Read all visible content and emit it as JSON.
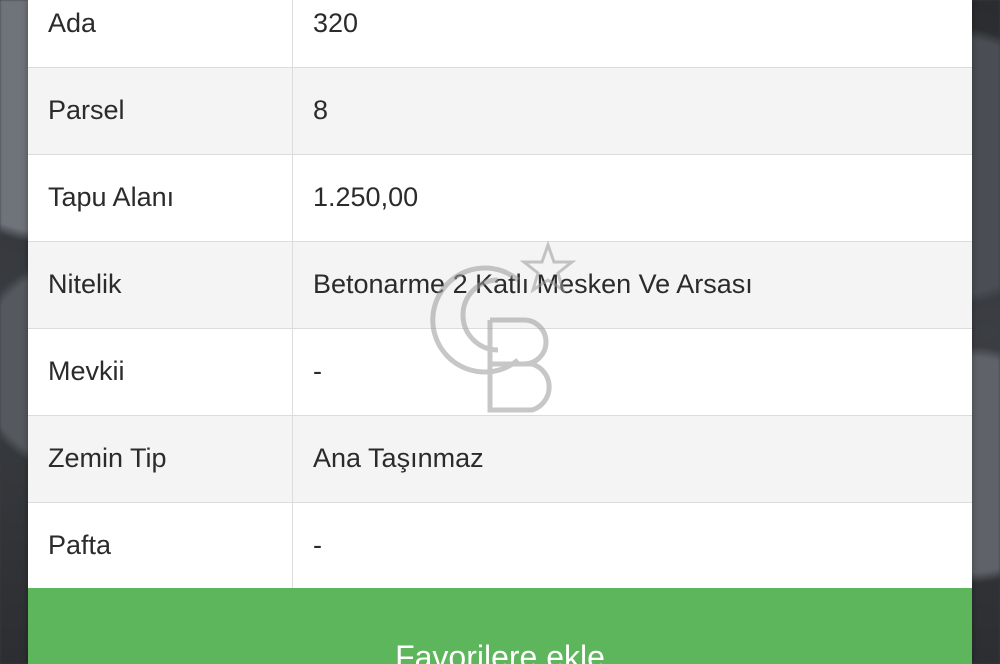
{
  "property_table": {
    "rows": [
      {
        "label": "Ada",
        "value": "320"
      },
      {
        "label": "Parsel",
        "value": "8"
      },
      {
        "label": "Tapu Alanı",
        "value": "1.250,00"
      },
      {
        "label": "Nitelik",
        "value": "Betonarme 2 Katlı Mesken Ve Arsası"
      },
      {
        "label": "Mevkii",
        "value": "-"
      },
      {
        "label": "Zemin Tip",
        "value": "Ana Taşınmaz"
      },
      {
        "label": "Pafta",
        "value": "-"
      }
    ]
  },
  "actions": {
    "favorite_label": "Favorilere ekle"
  },
  "watermark": {
    "icon": "coldwell-banker-logo"
  },
  "colors": {
    "button_green": "#5db65b",
    "text": "#2b2b2b",
    "border": "#dcdcdc"
  }
}
